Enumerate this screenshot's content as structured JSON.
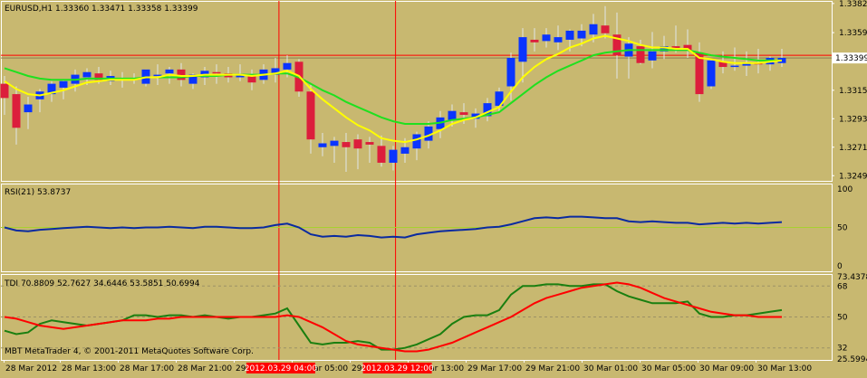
{
  "colors": {
    "background": "#c8b870",
    "frame": "#ffffff",
    "grid": "#9c9165",
    "text": "#000000",
    "bull_candle": "#0a34ff",
    "bear_candle": "#dc1e3c",
    "wick": "#e1e6ea",
    "ma_fast": "#ffff00",
    "ma_slow": "#1fe01f",
    "rsi_line": "#0a2aa0",
    "rsi_level": "#a8d030",
    "tdi_green": "#1a7f10",
    "tdi_red": "#ff0000",
    "vline": "#ff0000",
    "price_line": "#ff0000",
    "price_tag_bg": "#ffffff",
    "time_tag_bg": "#ff0000",
    "time_tag_text": "#ffffff"
  },
  "chart_data": [
    {
      "type": "candlestick",
      "title": "EURUSD,H1  1.33360 1.33471 1.33358 1.33399",
      "symbol": "EURUSD,H1",
      "ohlc_header": "1.33360 1.33471 1.33358 1.33399",
      "ylim": [
        1.3245,
        1.3384
      ],
      "y_ticks": [
        "1.33820",
        "1.33595",
        "1.33150",
        "1.32930",
        "1.32710",
        "1.32490"
      ],
      "y_tick_values": [
        1.3382,
        1.33595,
        1.3315,
        1.3293,
        1.3271,
        1.3249
      ],
      "current_price_label": "1.33399",
      "current_price": 1.33399,
      "red_level_price": 1.3342,
      "candles": [
        [
          1.332,
          1.3326,
          1.3296,
          1.3309
        ],
        [
          1.3312,
          1.3318,
          1.3273,
          1.3286
        ],
        [
          1.3298,
          1.331,
          1.3285,
          1.3304
        ],
        [
          1.3308,
          1.3316,
          1.3298,
          1.3314
        ],
        [
          1.3312,
          1.3322,
          1.3306,
          1.332
        ],
        [
          1.3317,
          1.3323,
          1.3308,
          1.3322
        ],
        [
          1.332,
          1.3331,
          1.3314,
          1.3327
        ],
        [
          1.3325,
          1.3332,
          1.3319,
          1.3329
        ],
        [
          1.3328,
          1.3333,
          1.332,
          1.3323
        ],
        [
          1.3322,
          1.333,
          1.3319,
          1.3326
        ],
        [
          1.3324,
          1.3329,
          1.3317,
          1.3324
        ],
        [
          1.3324,
          1.3328,
          1.332,
          1.3323
        ],
        [
          1.332,
          1.3331,
          1.3318,
          1.3331
        ],
        [
          1.3327,
          1.3335,
          1.3319,
          1.3327
        ],
        [
          1.3328,
          1.3333,
          1.332,
          1.3331
        ],
        [
          1.3331,
          1.3336,
          1.3318,
          1.3323
        ],
        [
          1.332,
          1.3328,
          1.3316,
          1.3327
        ],
        [
          1.3325,
          1.3333,
          1.3319,
          1.333
        ],
        [
          1.3329,
          1.3335,
          1.332,
          1.3328
        ],
        [
          1.3328,
          1.3333,
          1.3321,
          1.3325
        ],
        [
          1.3325,
          1.3335,
          1.3322,
          1.3327
        ],
        [
          1.3326,
          1.3331,
          1.3315,
          1.3321
        ],
        [
          1.3323,
          1.3335,
          1.332,
          1.3331
        ],
        [
          1.3327,
          1.334,
          1.3321,
          1.3332
        ],
        [
          1.3331,
          1.3342,
          1.3325,
          1.3336
        ],
        [
          1.3337,
          1.3339,
          1.331,
          1.3314
        ],
        [
          1.3314,
          1.3319,
          1.3266,
          1.3277
        ],
        [
          1.3271,
          1.3282,
          1.3264,
          1.3274
        ],
        [
          1.3272,
          1.3279,
          1.3259,
          1.3276
        ],
        [
          1.3275,
          1.3282,
          1.3252,
          1.3271
        ],
        [
          1.3277,
          1.3281,
          1.3254,
          1.327
        ],
        [
          1.3275,
          1.3279,
          1.3259,
          1.3273
        ],
        [
          1.3272,
          1.328,
          1.3256,
          1.3259
        ],
        [
          1.3259,
          1.3272,
          1.3253,
          1.3269
        ],
        [
          1.3266,
          1.3278,
          1.3259,
          1.3271
        ],
        [
          1.327,
          1.3283,
          1.3261,
          1.3281
        ],
        [
          1.3276,
          1.3291,
          1.327,
          1.3287
        ],
        [
          1.3285,
          1.3299,
          1.3278,
          1.3294
        ],
        [
          1.3292,
          1.3304,
          1.3287,
          1.3299
        ],
        [
          1.3298,
          1.3305,
          1.3289,
          1.3296
        ],
        [
          1.3293,
          1.3301,
          1.3286,
          1.3297
        ],
        [
          1.3295,
          1.3309,
          1.3291,
          1.3305
        ],
        [
          1.3303,
          1.3317,
          1.3299,
          1.3314
        ],
        [
          1.3318,
          1.3344,
          1.3307,
          1.334
        ],
        [
          1.3337,
          1.3363,
          1.3321,
          1.3356
        ],
        [
          1.3354,
          1.3363,
          1.3345,
          1.3352
        ],
        [
          1.3353,
          1.3363,
          1.3348,
          1.3358
        ],
        [
          1.3352,
          1.3365,
          1.3346,
          1.3356
        ],
        [
          1.3354,
          1.3362,
          1.3345,
          1.3361
        ],
        [
          1.3355,
          1.3366,
          1.3349,
          1.3361
        ],
        [
          1.3358,
          1.3374,
          1.3352,
          1.3366
        ],
        [
          1.3365,
          1.338,
          1.3355,
          1.3359
        ],
        [
          1.3358,
          1.3375,
          1.3324,
          1.3342
        ],
        [
          1.3341,
          1.3356,
          1.3324,
          1.3351
        ],
        [
          1.3349,
          1.3354,
          1.3335,
          1.3336
        ],
        [
          1.3338,
          1.336,
          1.3332,
          1.3345
        ],
        [
          1.3345,
          1.3357,
          1.3339,
          1.3349
        ],
        [
          1.3349,
          1.3365,
          1.3344,
          1.3347
        ],
        [
          1.335,
          1.3362,
          1.334,
          1.3346
        ],
        [
          1.3344,
          1.3352,
          1.3306,
          1.3312
        ],
        [
          1.3318,
          1.3339,
          1.3316,
          1.3338
        ],
        [
          1.3337,
          1.3345,
          1.3328,
          1.3333
        ],
        [
          1.3334,
          1.3348,
          1.333,
          1.3334
        ],
        [
          1.3334,
          1.3345,
          1.3326,
          1.3336
        ],
        [
          1.3336,
          1.3347,
          1.3328,
          1.3335
        ],
        [
          1.3335,
          1.3341,
          1.333,
          1.334
        ],
        [
          1.3336,
          1.3347,
          1.3333,
          1.334
        ]
      ],
      "ma_fast": [
        1.3322,
        1.3316,
        1.3312,
        1.3311,
        1.3313,
        1.3315,
        1.3318,
        1.3321,
        1.3322,
        1.3323,
        1.3323,
        1.3323,
        1.3325,
        1.3325,
        1.3327,
        1.3326,
        1.3326,
        1.3327,
        1.3327,
        1.3327,
        1.3327,
        1.3326,
        1.3327,
        1.3328,
        1.333,
        1.3326,
        1.3316,
        1.3308,
        1.3301,
        1.3294,
        1.3288,
        1.3284,
        1.3278,
        1.3276,
        1.3275,
        1.3277,
        1.328,
        1.3284,
        1.3289,
        1.3292,
        1.3294,
        1.3298,
        1.3302,
        1.3314,
        1.3325,
        1.3333,
        1.3339,
        1.3343,
        1.3348,
        1.3351,
        1.3355,
        1.3357,
        1.3355,
        1.3353,
        1.335,
        1.3348,
        1.3348,
        1.3347,
        1.3347,
        1.334,
        1.3339,
        1.3337,
        1.3336,
        1.3336,
        1.3336,
        1.3337,
        1.3338
      ],
      "ma_slow": [
        1.3332,
        1.3329,
        1.3326,
        1.3324,
        1.3323,
        1.3323,
        1.3323,
        1.3324,
        1.3324,
        1.3324,
        1.3324,
        1.3324,
        1.3325,
        1.3325,
        1.3325,
        1.3325,
        1.3326,
        1.3326,
        1.3326,
        1.3327,
        1.3327,
        1.3327,
        1.3327,
        1.3328,
        1.3328,
        1.3325,
        1.332,
        1.3315,
        1.3311,
        1.3306,
        1.3302,
        1.3298,
        1.3294,
        1.3291,
        1.3289,
        1.3289,
        1.3289,
        1.329,
        1.3292,
        1.3293,
        1.3294,
        1.3296,
        1.3298,
        1.3305,
        1.3312,
        1.3319,
        1.3325,
        1.333,
        1.3334,
        1.3338,
        1.3342,
        1.3344,
        1.3345,
        1.3346,
        1.3346,
        1.3346,
        1.3346,
        1.3346,
        1.3346,
        1.3344,
        1.3342,
        1.3341,
        1.334,
        1.3339,
        1.3338,
        1.3338,
        1.3338
      ]
    },
    {
      "type": "line",
      "title": "RSI(21) 53.8737",
      "ylim": [
        0,
        100
      ],
      "y_ticks": [
        "100",
        "50",
        "0"
      ],
      "levels": [
        50
      ],
      "series": [
        {
          "name": "RSI(21)",
          "values": [
            50,
            46,
            45,
            47,
            48,
            49,
            50,
            51,
            50,
            49,
            50,
            49,
            50,
            50,
            51,
            50,
            49,
            51,
            51,
            50,
            49,
            49,
            50,
            53,
            55,
            50,
            41,
            38,
            39,
            38,
            40,
            39,
            37,
            38,
            37,
            41,
            43,
            45,
            46,
            47,
            48,
            50,
            51,
            54,
            58,
            62,
            63,
            62,
            64,
            64,
            63,
            62,
            62,
            58,
            57,
            58,
            57,
            56,
            56,
            54,
            55,
            56,
            55,
            56,
            55,
            56,
            57
          ]
        }
      ]
    },
    {
      "type": "line",
      "title": "TDI 70.8809 52.7627 34.6446 53.5851 50.6994",
      "ylim": [
        25,
        75
      ],
      "y_ticks": [
        "73.4378",
        "68",
        "50",
        "32",
        "25.5994"
      ],
      "levels": [
        68,
        50,
        32
      ],
      "series": [
        {
          "name": "",
          "values": [
            50,
            49,
            47,
            45,
            44,
            43,
            44,
            45,
            46,
            47,
            48,
            48,
            48,
            49,
            49,
            50,
            50,
            50,
            50,
            50,
            50,
            50,
            50,
            50,
            51,
            50,
            47,
            44,
            40,
            36,
            34,
            33,
            32,
            31,
            30,
            30,
            31,
            33,
            35,
            38,
            41,
            44,
            47,
            50,
            54,
            58,
            61,
            63,
            65,
            67,
            68,
            69,
            70,
            69,
            67,
            64,
            61,
            59,
            57,
            55,
            53,
            52,
            51,
            51,
            50,
            50,
            50
          ]
        },
        {
          "name": "",
          "values": [
            42,
            40,
            41,
            46,
            48,
            47,
            46,
            45,
            46,
            47,
            48,
            51,
            51,
            50,
            51,
            51,
            50,
            51,
            50,
            49,
            50,
            50,
            51,
            52,
            55,
            45,
            35,
            34,
            35,
            35,
            36,
            35,
            31,
            31,
            32,
            34,
            37,
            40,
            46,
            50,
            51,
            51,
            54,
            63,
            68,
            68,
            69,
            69,
            68,
            68,
            69,
            69,
            65,
            62,
            60,
            58,
            58,
            58,
            59,
            52,
            50,
            50,
            51,
            51,
            52,
            53,
            54
          ]
        }
      ]
    }
  ],
  "x_labels": [
    "28 Mar 2012",
    "28 Mar 13:00",
    "28 Mar 17:00",
    "28 Mar 21:00",
    "29 Mar 01:00",
    "29 Mar 05:00",
    "29 Mar 09:00",
    "29 Mar 13:00",
    "29 Mar 17:00",
    "29 Mar 21:00",
    "30 Mar 01:00",
    "30 Mar 05:00",
    "30 Mar 09:00",
    "30 Mar 13:00"
  ],
  "time_tags": [
    "2012.03.29 04:00",
    "2012.03.29 12:00"
  ],
  "copyright": "MBT MetaTrader 4, © 2001-2011 MetaQuotes Software Corp."
}
